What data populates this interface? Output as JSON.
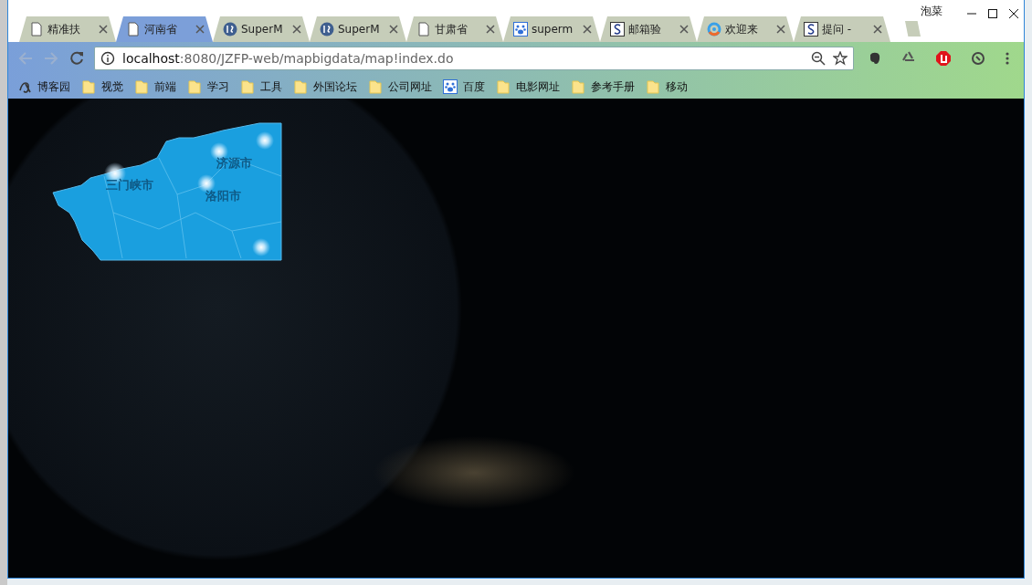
{
  "window": {
    "user": "泡菜"
  },
  "tabs": [
    {
      "title": "精准扶",
      "kind": "page",
      "selected": false
    },
    {
      "title": "河南省",
      "kind": "page",
      "selected": true
    },
    {
      "title": "SuperM",
      "kind": "supermap",
      "selected": false
    },
    {
      "title": "SuperM",
      "kind": "supermap",
      "selected": false
    },
    {
      "title": "甘肃省",
      "kind": "page",
      "selected": false
    },
    {
      "title": "superm",
      "kind": "paw",
      "selected": false
    },
    {
      "title": "邮箱验",
      "kind": "s",
      "selected": false
    },
    {
      "title": "欢迎来",
      "kind": "ring",
      "selected": false
    },
    {
      "title": "提问 -",
      "kind": "s",
      "selected": false
    }
  ],
  "address_bar": {
    "host": "localhost",
    "rest": ":8080/JZFP-web/mapbigdata/map!index.do"
  },
  "bookmarks": [
    {
      "label": "博客园",
      "kind": "logo"
    },
    {
      "label": "视觉",
      "kind": "folder"
    },
    {
      "label": "前端",
      "kind": "folder"
    },
    {
      "label": "学习",
      "kind": "folder"
    },
    {
      "label": "工具",
      "kind": "folder"
    },
    {
      "label": "外国论坛",
      "kind": "folder"
    },
    {
      "label": "公司网址",
      "kind": "folder"
    },
    {
      "label": "百度",
      "kind": "paw"
    },
    {
      "label": "电影网址",
      "kind": "folder"
    },
    {
      "label": "参考手册",
      "kind": "folder"
    },
    {
      "label": "移动",
      "kind": "folder"
    }
  ],
  "map": {
    "labels": [
      "济源市",
      "三门峡市",
      "洛阳市"
    ]
  }
}
